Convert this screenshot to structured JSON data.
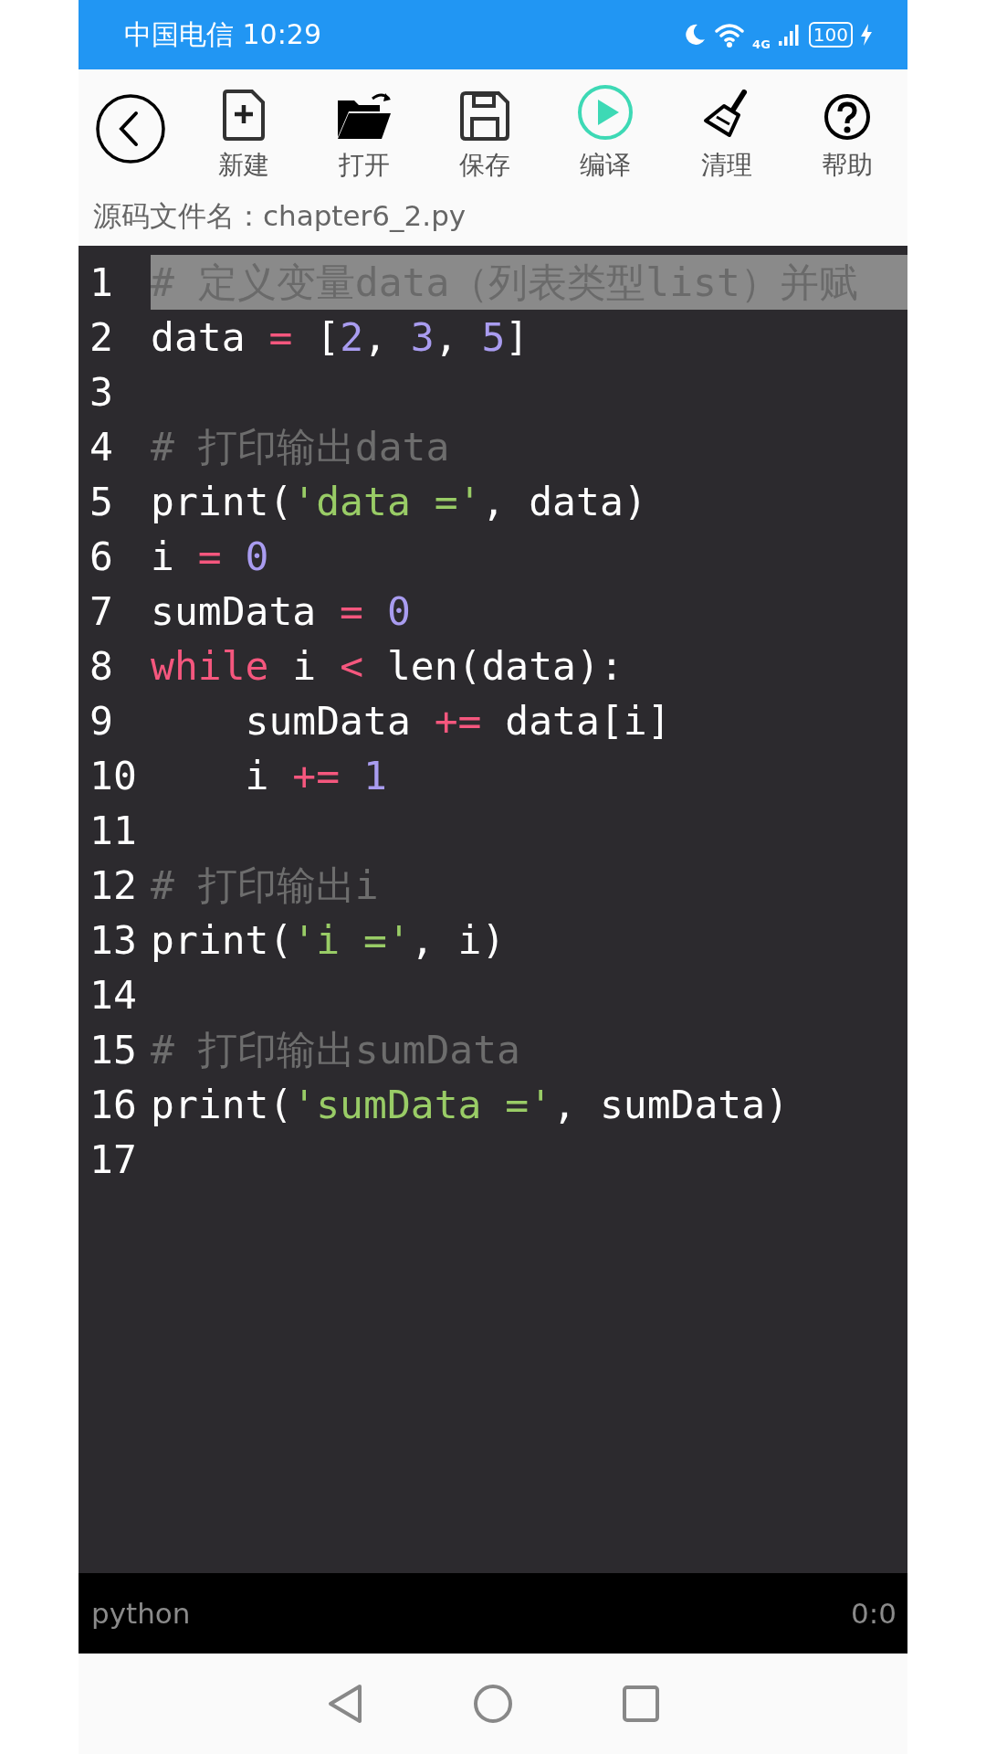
{
  "status_bar": {
    "carrier_time": "中国电信 10:29",
    "network": "4G",
    "battery": "100"
  },
  "toolbar": {
    "items": [
      {
        "kind": "new",
        "label": "新建"
      },
      {
        "kind": "open",
        "label": "打开"
      },
      {
        "kind": "save",
        "label": "保存"
      },
      {
        "kind": "run",
        "label": "编译"
      },
      {
        "kind": "clean",
        "label": "清理"
      },
      {
        "kind": "help",
        "label": "帮助"
      }
    ]
  },
  "file_name": "源码文件名：chapter6_2.py",
  "editor": {
    "lines": [
      {
        "number": "1",
        "highlighted": true,
        "tokens": [
          {
            "kind": "comment",
            "text": "# 定义变量data（列表类型list）并赋"
          }
        ]
      },
      {
        "number": "2",
        "highlighted": false,
        "tokens": [
          {
            "kind": "plain",
            "text": "data "
          },
          {
            "kind": "op",
            "text": "="
          },
          {
            "kind": "plain",
            "text": " ["
          },
          {
            "kind": "num",
            "text": "2"
          },
          {
            "kind": "plain",
            "text": ", "
          },
          {
            "kind": "num",
            "text": "3"
          },
          {
            "kind": "plain",
            "text": ", "
          },
          {
            "kind": "num",
            "text": "5"
          },
          {
            "kind": "plain",
            "text": "]"
          }
        ]
      },
      {
        "number": "3",
        "highlighted": false
      },
      {
        "number": "4",
        "highlighted": false,
        "tokens": [
          {
            "kind": "comment",
            "text": "# 打印输出data"
          }
        ]
      },
      {
        "number": "5",
        "highlighted": false,
        "tokens": [
          {
            "kind": "plain",
            "text": "print("
          },
          {
            "kind": "str",
            "text": "'data ='"
          },
          {
            "kind": "plain",
            "text": ", data)"
          }
        ]
      },
      {
        "number": "6",
        "highlighted": false,
        "tokens": [
          {
            "kind": "plain",
            "text": "i "
          },
          {
            "kind": "op",
            "text": "="
          },
          {
            "kind": "num",
            "text": " 0"
          }
        ]
      },
      {
        "number": "7",
        "highlighted": false,
        "tokens": [
          {
            "kind": "plain",
            "text": "sumData "
          },
          {
            "kind": "op",
            "text": "="
          },
          {
            "kind": "num",
            "text": " 0"
          }
        ]
      },
      {
        "number": "8",
        "highlighted": false,
        "tokens": [
          {
            "kind": "op",
            "text": "while"
          },
          {
            "kind": "plain",
            "text": " i "
          },
          {
            "kind": "op",
            "text": "<"
          },
          {
            "kind": "plain",
            "text": " len(data):"
          }
        ]
      },
      {
        "number": "9",
        "highlighted": false,
        "tokens": [
          {
            "kind": "plain",
            "text": "    sumData "
          },
          {
            "kind": "op",
            "text": "+="
          },
          {
            "kind": "plain",
            "text": " data[i]"
          }
        ]
      },
      {
        "number": "10",
        "highlighted": false,
        "tokens": [
          {
            "kind": "plain",
            "text": "    i "
          },
          {
            "kind": "op",
            "text": "+="
          },
          {
            "kind": "num",
            "text": " 1"
          }
        ]
      },
      {
        "number": "11",
        "highlighted": false
      },
      {
        "number": "12",
        "highlighted": false,
        "tokens": [
          {
            "kind": "comment",
            "text": "# 打印输出i"
          }
        ]
      },
      {
        "number": "13",
        "highlighted": false,
        "tokens": [
          {
            "kind": "plain",
            "text": "print("
          },
          {
            "kind": "str",
            "text": "'i ='"
          },
          {
            "kind": "plain",
            "text": ", i)"
          }
        ]
      },
      {
        "number": "14",
        "highlighted": false
      },
      {
        "number": "15",
        "highlighted": false,
        "tokens": [
          {
            "kind": "comment",
            "text": "# 打印输出sumData"
          }
        ]
      },
      {
        "number": "16",
        "highlighted": false,
        "tokens": [
          {
            "kind": "plain",
            "text": "print("
          },
          {
            "kind": "str",
            "text": "'sumData ='"
          },
          {
            "kind": "plain",
            "text": ", sumData)"
          }
        ]
      },
      {
        "number": "17",
        "highlighted": false
      }
    ]
  },
  "footer": {
    "language": "python",
    "cursor": "0:0"
  }
}
